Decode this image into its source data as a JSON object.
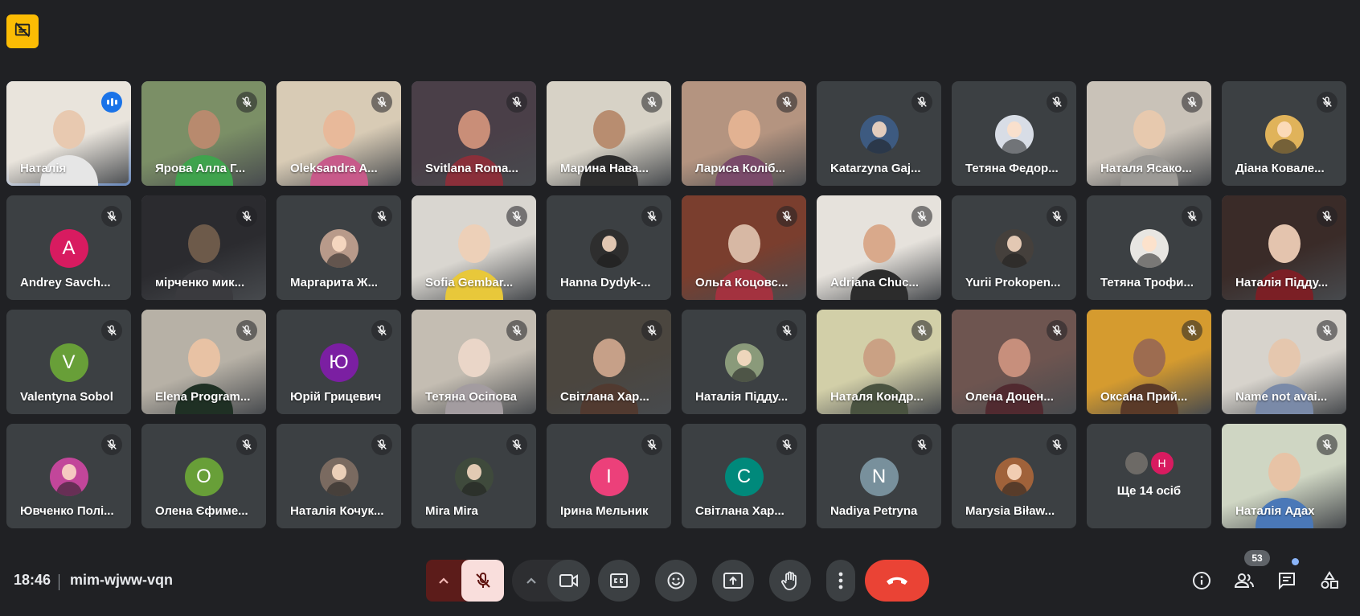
{
  "meeting": {
    "time": "18:46",
    "code": "mim-wjww-vqn",
    "participants_badge": "53"
  },
  "icons": {
    "recording": "recording-off-icon",
    "muted": "mic-off-icon",
    "speaking": "audio-level-icon"
  },
  "colors": {
    "background": "#202124",
    "tile": "#3c4043",
    "active_border": "#8ab4f8",
    "end_call": "#ea4335",
    "mic_muted_bg": "#f9dedc",
    "record_badge": "#fbbc04"
  },
  "participants": [
    {
      "name": "Наталія",
      "kind": "video",
      "active": true,
      "bg": "#e9e4dc",
      "head": "#e8c9b0",
      "body": "#e6e6e6"
    },
    {
      "name": "Ярова Алла Г...",
      "kind": "video",
      "bg": "#7b8f66",
      "head": "#b88a6e",
      "body": "#3fa34d"
    },
    {
      "name": "Oleksandra A...",
      "kind": "video",
      "bg": "#d8cbb5",
      "head": "#e8b99a",
      "body": "#c85a8a"
    },
    {
      "name": "Svitlana Roma...",
      "kind": "video",
      "bg": "#4a3f48",
      "head": "#c98e78",
      "body": "#8a2f3a"
    },
    {
      "name": "Марина Нава...",
      "kind": "video",
      "bg": "#d7d2c6",
      "head": "#b88d70",
      "body": "#2d2d2d"
    },
    {
      "name": "Лариса Коліб...",
      "kind": "video",
      "bg": "#b49480",
      "head": "#e2b292",
      "body": "#7a4a6a"
    },
    {
      "name": "Katarzyna Gaj...",
      "kind": "avatar",
      "avatar_color": "#3d5a80",
      "photo": true
    },
    {
      "name": "Тетяна Федор...",
      "kind": "avatar",
      "avatar_color": "#d8dde6",
      "photo": true
    },
    {
      "name": "Наталя Ясако...",
      "kind": "video",
      "bg": "#c9c2b8",
      "head": "#e7c9ae",
      "body": "#9c9a96"
    },
    {
      "name": "Діана Ковале...",
      "kind": "avatar",
      "avatar_color": "#e0b35a",
      "photo": true
    },
    {
      "name": "Andrey Savch...",
      "kind": "avatar",
      "letter": "A",
      "avatar_color": "#d81b60"
    },
    {
      "name": "мірченко мик...",
      "kind": "video",
      "bg": "#2b2b2f",
      "head": "#6d5a4a",
      "body": "#3a3a3e"
    },
    {
      "name": "Маргарита Ж...",
      "kind": "avatar",
      "avatar_color": "#b89a8a",
      "photo": true
    },
    {
      "name": "Sofia Gembar...",
      "kind": "video",
      "bg": "#d9d6d0",
      "head": "#edd0b8",
      "body": "#e8c83a"
    },
    {
      "name": "Hanna Dydyk-...",
      "kind": "avatar",
      "avatar_color": "#2e2e2e",
      "photo": true
    },
    {
      "name": "Ольга Коцовс...",
      "kind": "video",
      "bg": "#7a3e2e",
      "head": "#d7b8a4",
      "body": "#a3323f"
    },
    {
      "name": "Adriana Chuc...",
      "kind": "video",
      "bg": "#e6e2dc",
      "head": "#d9a98b",
      "body": "#2c2c2c"
    },
    {
      "name": "Yurii Prokopen...",
      "kind": "avatar",
      "avatar_color": "#45403c",
      "photo": true
    },
    {
      "name": "Тетяна Трофи...",
      "kind": "avatar",
      "avatar_color": "#e8e6e2",
      "photo": true
    },
    {
      "name": "Наталія Підду...",
      "kind": "video",
      "bg": "#3a2b28",
      "head": "#e4c4ae",
      "body": "#7b1f25"
    },
    {
      "name": "Valentyna Sobol",
      "kind": "avatar",
      "letter": "V",
      "avatar_color": "#689f38"
    },
    {
      "name": "Elena Program...",
      "kind": "video",
      "bg": "#b7b1a6",
      "head": "#e8c2a4",
      "body": "#1f3024"
    },
    {
      "name": "Юрій Грицевич",
      "kind": "avatar",
      "letter": "Ю",
      "avatar_color": "#7b1fa2"
    },
    {
      "name": "Тетяна Осіпова",
      "kind": "video",
      "bg": "#c4bdb2",
      "head": "#ead6c8",
      "body": "#a39ca0"
    },
    {
      "name": "Світлана Хар...",
      "kind": "video",
      "bg": "#4b463f",
      "head": "#c6a088",
      "body": "#513a30"
    },
    {
      "name": "Наталія Підду...",
      "kind": "avatar",
      "avatar_color": "#8a9a7a",
      "photo": true
    },
    {
      "name": "Наталя Кондр...",
      "kind": "video",
      "bg": "#d2cfa8",
      "head": "#caa184",
      "body": "#4a5340"
    },
    {
      "name": "Олена Доцен...",
      "kind": "video",
      "bg": "#6e5550",
      "head": "#c78f7c",
      "body": "#512a30"
    },
    {
      "name": "Оксана Прий...",
      "kind": "video",
      "bg": "#d59b2f",
      "head": "#9d6c50",
      "body": "#5a3a28"
    },
    {
      "name": "Name not avai...",
      "kind": "video",
      "bg": "#d7d3cc",
      "head": "#e5c7ae",
      "body": "#7a8aa8"
    },
    {
      "name": "Ювченко Полі...",
      "kind": "avatar",
      "avatar_color": "#c2469a",
      "photo": true
    },
    {
      "name": "Олена Єфиме...",
      "kind": "avatar",
      "letter": "О",
      "avatar_color": "#689f38"
    },
    {
      "name": "Наталія Кочук...",
      "kind": "avatar",
      "avatar_color": "#7a6a60",
      "photo": true
    },
    {
      "name": "Mira Mira",
      "kind": "avatar",
      "avatar_color": "#3f4a3c",
      "photo": true
    },
    {
      "name": "Ірина Мельник",
      "kind": "avatar",
      "letter": "І",
      "avatar_color": "#ec407a"
    },
    {
      "name": "Світлана Хар...",
      "kind": "avatar",
      "letter": "С",
      "avatar_color": "#00897b"
    },
    {
      "name": "Nadiya Petryna",
      "kind": "avatar",
      "letter": "N",
      "avatar_color": "#78909c"
    },
    {
      "name": "Marysia Biław...",
      "kind": "avatar",
      "avatar_color": "#a0623a",
      "photo": true
    },
    {
      "name": "Ще 14 осіб",
      "kind": "more",
      "letter": "H",
      "avatar_color": "#d81b60",
      "avatar2_color": "#6d6a66"
    },
    {
      "name": "Наталія Адах",
      "kind": "video",
      "bg": "#cfd6c3",
      "head": "#e7c3a6",
      "body": "#4a78b8"
    }
  ]
}
